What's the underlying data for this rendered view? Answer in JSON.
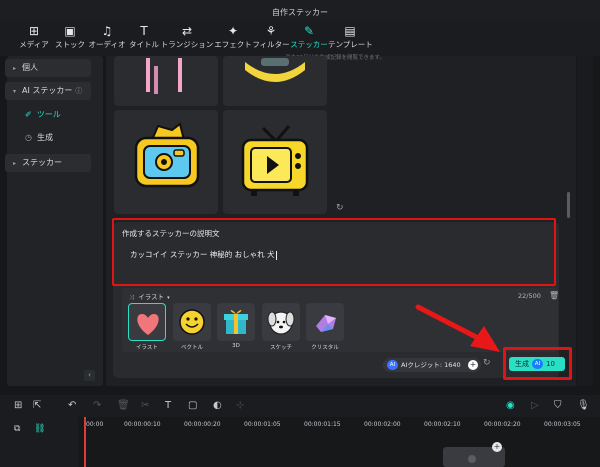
{
  "window": {
    "title": "自作ステッカー"
  },
  "toolbar": {
    "items": [
      {
        "label": "メディア",
        "icon": "media-icon"
      },
      {
        "label": "ストック",
        "icon": "stock-icon"
      },
      {
        "label": "オーディオ",
        "icon": "music-note-icon"
      },
      {
        "label": "タイトル",
        "icon": "text-title-icon"
      },
      {
        "label": "トランジション",
        "icon": "transition-icon"
      },
      {
        "label": "エフェクト",
        "icon": "effect-sparkle-icon"
      },
      {
        "label": "フィルター",
        "icon": "filter-icon"
      },
      {
        "label": "ステッカー",
        "icon": "sticker-icon"
      },
      {
        "label": "テンプレート",
        "icon": "template-icon"
      }
    ],
    "active": "ステッカー"
  },
  "sidebar": {
    "items": [
      {
        "label": "個人"
      },
      {
        "label": "AI ステッカー"
      },
      {
        "label": "ツール"
      },
      {
        "label": "生成"
      },
      {
        "label": "ステッカー"
      }
    ]
  },
  "hint": "過去30日分の生成記録を閲覧できます。",
  "description": {
    "label": "作成するステッカーの説明文",
    "value": "カッコイイ ステッカー 神秘的 おしゃれ 犬",
    "counter": "22/500"
  },
  "style": {
    "selected_label": "イラスト",
    "options": [
      {
        "label": "イラスト",
        "icon": "heart-sticker-icon"
      },
      {
        "label": "ベクトル",
        "icon": "smiley-sticker-icon"
      },
      {
        "label": "3D",
        "icon": "gift-box-icon"
      },
      {
        "label": "スケッチ",
        "icon": "dog-sketch-icon"
      },
      {
        "label": "クリスタル",
        "icon": "crystal-icon"
      }
    ]
  },
  "credits": {
    "label": "AIクレジット: 1640"
  },
  "generate": {
    "label": "生成",
    "cost": "10"
  },
  "timeline": {
    "ticks": [
      "00:00",
      "00:00:00:10",
      "00:00:00:20",
      "00:00:01:05",
      "00:00:01:15",
      "00:00:02:00",
      "00:00:02:10",
      "00:00:02:20",
      "00:00:03:05"
    ]
  },
  "colors": {
    "accent": "#29e0c6",
    "highlight": "#e01414",
    "ai_badge": "#3a73ff"
  }
}
